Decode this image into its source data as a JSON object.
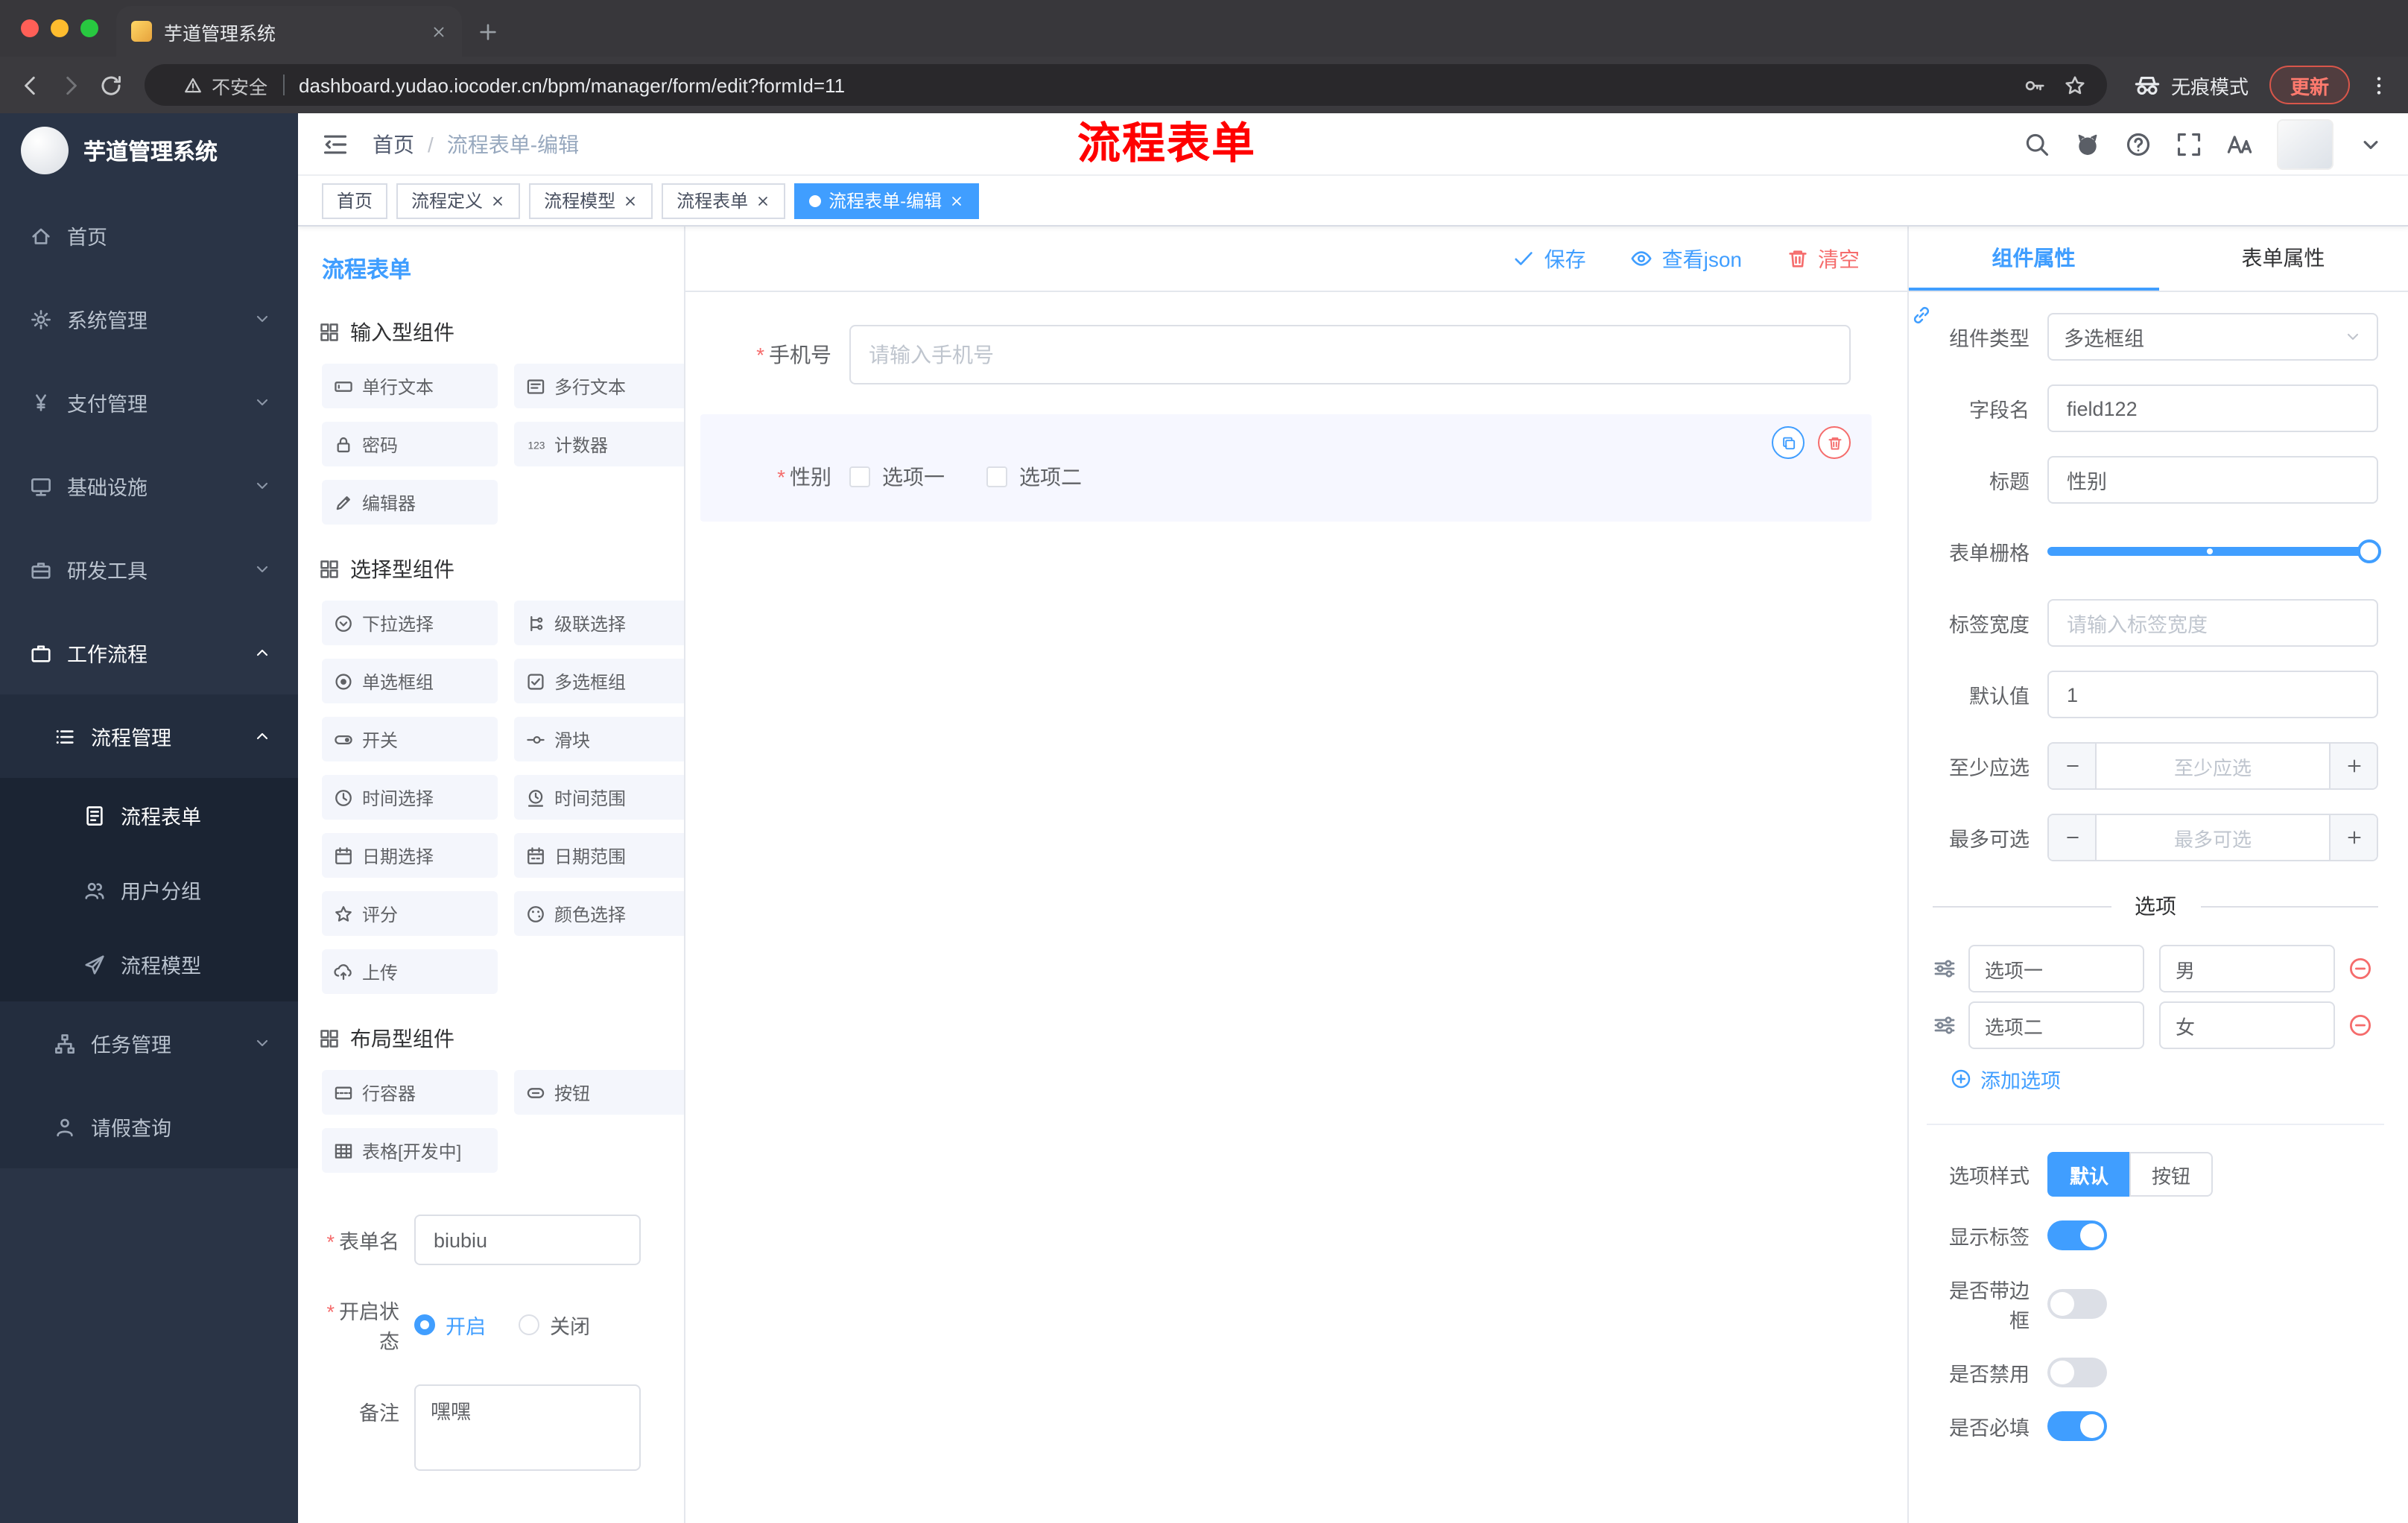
{
  "colors": {
    "primary": "#409EFF",
    "danger": "#F56C6C",
    "annotation_red": "#FF0000",
    "sidebar_bg": "#2A3446",
    "traffic_lights": [
      "#FF5F57",
      "#FEBC2E",
      "#28C840"
    ]
  },
  "browser": {
    "tab_title": "芋道管理系统",
    "security_label": "不安全",
    "url": "dashboard.yudao.iocoder.cn/bpm/manager/form/edit?formId=11",
    "incognito_label": "无痕模式",
    "update_label": "更新"
  },
  "sidebar": {
    "logo_title": "芋道管理系统",
    "items": [
      {
        "key": "home",
        "label": "首页",
        "icon": "home-icon",
        "level": 1
      },
      {
        "key": "system-mgmt",
        "label": "系统管理",
        "icon": "gear-icon",
        "level": 1,
        "chevron": "down"
      },
      {
        "key": "payment-mgmt",
        "label": "支付管理",
        "icon": "yen-icon",
        "level": 1,
        "chevron": "down"
      },
      {
        "key": "infrastructure",
        "label": "基础设施",
        "icon": "monitor-icon",
        "level": 1,
        "chevron": "down"
      },
      {
        "key": "dev-tools",
        "label": "研发工具",
        "icon": "toolbox-icon",
        "level": 1,
        "chevron": "down"
      },
      {
        "key": "workflow",
        "label": "工作流程",
        "icon": "briefcase-icon",
        "level": 1,
        "chevron": "up",
        "bright": true
      },
      {
        "key": "process-mgmt",
        "label": "流程管理",
        "icon": "list-icon",
        "level": 2,
        "chevron": "up",
        "bright": true
      },
      {
        "key": "process-form",
        "label": "流程表单",
        "icon": "document-icon",
        "level": 3,
        "bright": true
      },
      {
        "key": "user-group",
        "label": "用户分组",
        "icon": "users-icon",
        "level": 3
      },
      {
        "key": "process-model",
        "label": "流程模型",
        "icon": "send-icon",
        "level": 3
      },
      {
        "key": "task-mgmt",
        "label": "任务管理",
        "icon": "tree-icon",
        "level": 2,
        "chevron": "down"
      },
      {
        "key": "leave-query",
        "label": "请假查询",
        "icon": "user-icon",
        "level": 2
      }
    ]
  },
  "header": {
    "breadcrumb": {
      "home": "首页",
      "separator": "/",
      "current": "流程表单-编辑"
    },
    "annotation": "流程表单"
  },
  "tags": [
    {
      "label": "首页",
      "closable": false,
      "active": false
    },
    {
      "label": "流程定义",
      "closable": true,
      "active": false
    },
    {
      "label": "流程模型",
      "closable": true,
      "active": false
    },
    {
      "label": "流程表单",
      "closable": true,
      "active": false
    },
    {
      "label": "流程表单-编辑",
      "closable": true,
      "active": true
    }
  ],
  "designer": {
    "panel_title": "流程表单",
    "actions": {
      "save": "保存",
      "view_json": "查看json",
      "clear": "清空"
    },
    "palette_groups": [
      {
        "title": "输入型组件",
        "items": [
          {
            "label": "单行文本",
            "icon": "input-icon"
          },
          {
            "label": "多行文本",
            "icon": "textarea-icon"
          },
          {
            "label": "密码",
            "icon": "password-icon"
          },
          {
            "label": "计数器",
            "icon": "counter-icon"
          },
          {
            "label": "编辑器",
            "icon": "editor-icon"
          }
        ]
      },
      {
        "title": "选择型组件",
        "items": [
          {
            "label": "下拉选择",
            "icon": "select-icon"
          },
          {
            "label": "级联选择",
            "icon": "cascader-icon"
          },
          {
            "label": "单选框组",
            "icon": "radio-icon"
          },
          {
            "label": "多选框组",
            "icon": "checkbox-icon"
          },
          {
            "label": "开关",
            "icon": "switch-icon"
          },
          {
            "label": "滑块",
            "icon": "slider-icon"
          },
          {
            "label": "时间选择",
            "icon": "time-icon"
          },
          {
            "label": "时间范围",
            "icon": "time-range-icon"
          },
          {
            "label": "日期选择",
            "icon": "date-icon"
          },
          {
            "label": "日期范围",
            "icon": "date-range-icon"
          },
          {
            "label": "评分",
            "icon": "rate-icon"
          },
          {
            "label": "颜色选择",
            "icon": "color-icon"
          },
          {
            "label": "上传",
            "icon": "upload-icon"
          }
        ]
      },
      {
        "title": "布局型组件",
        "items": [
          {
            "label": "行容器",
            "icon": "row-icon"
          },
          {
            "label": "按钮",
            "icon": "button-icon"
          },
          {
            "label": "表格[开发中]",
            "icon": "table-icon"
          }
        ]
      }
    ],
    "meta": {
      "name_label": "表单名",
      "name_value": "biubiu",
      "status_label": "开启状态",
      "status_on": "开启",
      "status_off": "关闭",
      "remark_label": "备注",
      "remark_value": "嘿嘿"
    },
    "canvas": {
      "phone": {
        "label": "手机号",
        "placeholder": "请输入手机号"
      },
      "gender": {
        "label": "性别",
        "option1": "选项一",
        "option2": "选项二"
      }
    }
  },
  "properties": {
    "tab_component": "组件属性",
    "tab_form": "表单属性",
    "component_type": {
      "label": "组件类型",
      "value": "多选框组"
    },
    "field_name": {
      "label": "字段名",
      "value": "field122"
    },
    "title": {
      "label": "标题",
      "value": "性别"
    },
    "grid": {
      "label": "表单栅格"
    },
    "label_width": {
      "label": "标签宽度",
      "placeholder": "请输入标签宽度"
    },
    "default_value": {
      "label": "默认值",
      "value": "1"
    },
    "min_select": {
      "label": "至少应选",
      "placeholder": "至少应选"
    },
    "max_select": {
      "label": "最多可选",
      "placeholder": "最多可选"
    },
    "options_title": "选项",
    "options": [
      {
        "label": "选项一",
        "value": "男"
      },
      {
        "label": "选项二",
        "value": "女"
      }
    ],
    "add_option": "添加选项",
    "option_style": {
      "label": "选项样式",
      "default": "默认",
      "button": "按钮",
      "selected": "默认"
    },
    "toggles": [
      {
        "key": "show-label",
        "label": "显示标签",
        "on": true
      },
      {
        "key": "border",
        "label": "是否带边框",
        "on": false
      },
      {
        "key": "disabled",
        "label": "是否禁用",
        "on": false
      },
      {
        "key": "required",
        "label": "是否必填",
        "on": true
      }
    ]
  }
}
